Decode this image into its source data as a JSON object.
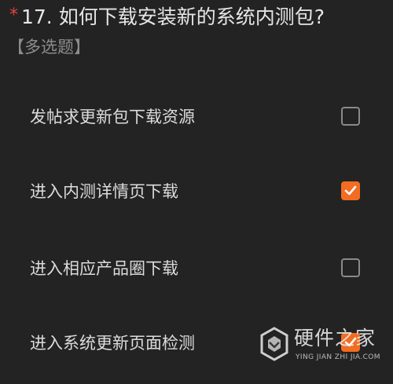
{
  "question": {
    "required_mark": "*",
    "title": "17. 如何下载安装新的系统内测包?",
    "type": "【多选题】"
  },
  "options": [
    {
      "label": "发帖求更新包下载资源",
      "checked": false
    },
    {
      "label": "进入内测详情页下载",
      "checked": true
    },
    {
      "label": "进入相应产品圈下载",
      "checked": false
    },
    {
      "label": "进入系统更新页面检测",
      "checked": true
    }
  ],
  "watermark": {
    "name": "硬件之家",
    "sub": "YING JIAN ZHI JIA.COM"
  },
  "colors": {
    "background": "#232323",
    "accent": "#f26d21",
    "required": "#e8413f"
  },
  "icons": {
    "checkbox_checked": "checkmark-icon",
    "watermark_logo": "hexagon-logo-icon"
  }
}
